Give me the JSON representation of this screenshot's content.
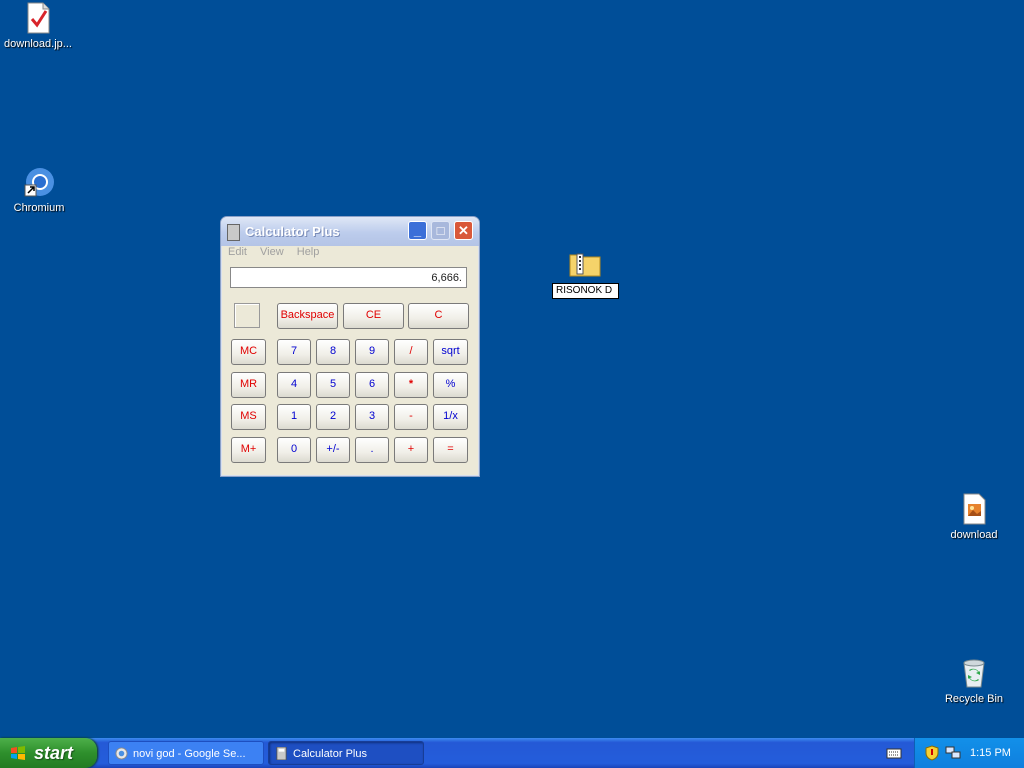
{
  "desktop": {
    "icons": [
      {
        "label": "download.jp...",
        "icon": "image-document-icon"
      },
      {
        "label": "Chromium",
        "icon": "chromium-shortcut-icon"
      },
      {
        "label": "download",
        "icon": "image-file-icon"
      },
      {
        "label": "Recycle Bin",
        "icon": "recycle-bin-icon"
      }
    ],
    "rename_value": "RISONOK D"
  },
  "calculator": {
    "title": "Calculator Plus",
    "menu": [
      "Edit",
      "View",
      "Help"
    ],
    "display": "6,666.",
    "buttons": {
      "backspace": "Backspace",
      "ce": "CE",
      "c": "C",
      "mc": "MC",
      "mr": "MR",
      "ms": "MS",
      "mplus": "M+",
      "n7": "7",
      "n8": "8",
      "n9": "9",
      "div": "/",
      "sqrt": "sqrt",
      "n4": "4",
      "n5": "5",
      "n6": "6",
      "mul": "*",
      "pct": "%",
      "n1": "1",
      "n2": "2",
      "n3": "3",
      "sub": "-",
      "inv": "1/x",
      "n0": "0",
      "sign": "+/-",
      "dot": ".",
      "add": "+",
      "eq": "="
    }
  },
  "taskbar": {
    "start_label": "start",
    "tasks": [
      {
        "label": "novi god - Google Se...",
        "icon": "chrome-icon"
      },
      {
        "label": "Calculator Plus",
        "icon": "calculator-icon"
      }
    ],
    "clock": "1:15 PM"
  },
  "colors": {
    "desktop": "#004e98",
    "taskbar": "#245ddb",
    "start": "#2e8f2c",
    "calc_red": "#e00000",
    "calc_blue": "#0000d0"
  }
}
